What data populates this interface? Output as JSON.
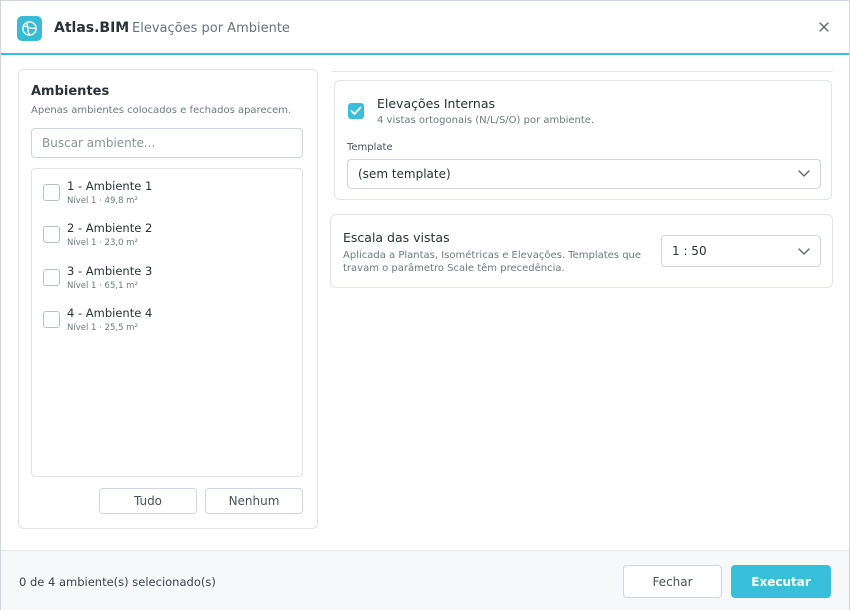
{
  "header": {
    "app_name": "Atlas.BIM",
    "separator": "·",
    "subtitle": "Elevações por Ambiente"
  },
  "rooms_panel": {
    "title": "Ambientes",
    "hint": "Apenas ambientes colocados e fechados aparecem.",
    "search_placeholder": "Buscar ambiente...",
    "items": [
      {
        "name": "1 - Ambiente 1",
        "meta": "Nível 1 · 49,8 m²",
        "checked": false
      },
      {
        "name": "2 - Ambiente 2",
        "meta": "Nível 1 · 23,0 m²",
        "checked": false
      },
      {
        "name": "3 - Ambiente 3",
        "meta": "Nível 1 · 65,1 m²",
        "checked": false
      },
      {
        "name": "4 - Ambiente 4",
        "meta": "Nível 1 · 25,5 m²",
        "checked": false
      }
    ],
    "select_all_label": "Tudo",
    "select_none_label": "Nenhum"
  },
  "elevations_card": {
    "checked": true,
    "title": "Elevações Internas",
    "hint": "4 vistas ortogonais (N/L/S/O) por ambiente.",
    "template_label": "Template",
    "template_value": "(sem template)"
  },
  "scale_card": {
    "title": "Escala das vistas",
    "hint": "Aplicada a Plantas, Isométricas e Elevações. Templates que travam o parâmetro Scale têm precedência.",
    "scale_value": "1 : 50"
  },
  "footer": {
    "status": "0 de 4 ambiente(s) selecionado(s)",
    "close_label": "Fechar",
    "run_label": "Executar"
  },
  "colors": {
    "accent": "#38bfd9"
  }
}
